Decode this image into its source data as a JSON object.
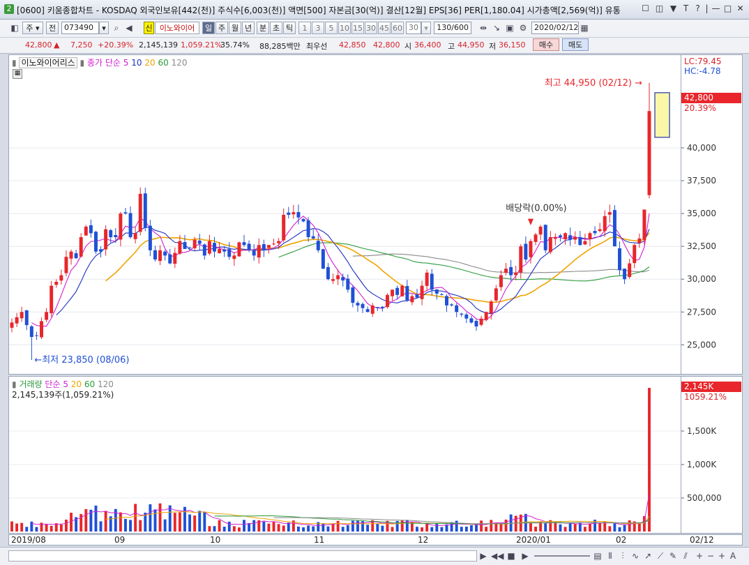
{
  "window": {
    "badge": "2",
    "title": "[0600] 키움종합차트 - KOSDAQ 외국인보유[442(천)] 주식수[6,003(천)] 액면[500] 자본금[30(억)] 결산[12월] EPS[36] PER[1,180.04] 시가총액[2,569(억)] 유통",
    "controls": [
      "☐",
      "◫",
      "▼",
      "T",
      "?",
      "|",
      "—",
      "□",
      "✕"
    ]
  },
  "toolbar": {
    "market_sel": "주",
    "prev_label": "전",
    "code": "073490",
    "badge_sin": "신",
    "stock_name": "이노와이어",
    "periods": [
      "일",
      "주",
      "월",
      "년",
      "분",
      "초",
      "틱"
    ],
    "active_period": "일",
    "minutes": [
      "1",
      "3",
      "5",
      "10",
      "15",
      "30",
      "45",
      "60",
      "30"
    ],
    "count": "130/600",
    "date": "2020/02/12"
  },
  "quote": {
    "price": "42,800",
    "arrow": "▲",
    "change": "7,250",
    "change_pct": "+20.39%",
    "volume": "2,145,139",
    "vol_ratio": "1,059.21%",
    "turnover": "35.74%",
    "amount": "88,285백만",
    "best_label": "최우선",
    "best_ask": "42,850",
    "best_bid": "42,800",
    "open_label": "시",
    "open": "36,400",
    "high_label": "고",
    "high": "44,950",
    "low_label": "저",
    "low": "36,150",
    "buy_label": "매수",
    "sell_label": "매도"
  },
  "price_panel": {
    "name": "이노와이어리스",
    "ma_label": "종가 단순",
    "ma_periods": [
      "5",
      "10",
      "20",
      "60",
      "120"
    ],
    "lc": "LC:79.45",
    "hc": "HC:-4.78",
    "high_note": "최고 44,950 (02/12)",
    "low_note": "최저 23,850 (08/06)",
    "dividend_note": "배당락(0.00%)",
    "last_price_label": "42,800",
    "last_pct_label": "20.39%",
    "y_ticks": [
      "40,000",
      "37,500",
      "35,000",
      "32,500",
      "30,000",
      "27,500",
      "25,000"
    ]
  },
  "volume_panel": {
    "name": "거래량",
    "ma_label": "단순",
    "ma_periods": [
      "5",
      "20",
      "60",
      "120"
    ],
    "current": "2,145,139주(1,059.21%)",
    "last_label": "2,145K",
    "last_pct": "1059.21%",
    "y_ticks": [
      "1,500K",
      "1,000K",
      "500,000"
    ]
  },
  "date_axis": {
    "labels": [
      "2019/08",
      "09",
      "10",
      "11",
      "12",
      "2020/01",
      "02"
    ],
    "last_date": "02/12"
  },
  "colors": {
    "up": "#e8262b",
    "down": "#1f50d6",
    "ma5": "#d21fd2",
    "ma10": "#1d2fbf",
    "ma20": "#f0a400",
    "ma60": "#2a9a3a",
    "ma120": "#8a8a8a"
  },
  "chart_data": {
    "type": "candlestick",
    "ylim": [
      23000,
      46000
    ],
    "y_ticks": [
      25000,
      27500,
      30000,
      32500,
      35000,
      37500,
      40000
    ],
    "volume_ylim": [
      0,
      2250000
    ],
    "volume_ticks": [
      500000,
      1000000,
      1500000
    ],
    "closes": [
      26700,
      27100,
      27500,
      26500,
      25600,
      25700,
      26800,
      27500,
      29500,
      29800,
      30300,
      31700,
      32100,
      31600,
      33200,
      34000,
      33500,
      32100,
      32100,
      33800,
      33200,
      33200,
      35000,
      35000,
      33200,
      33500,
      36500,
      33900,
      32200,
      31500,
      32200,
      31800,
      31200,
      32000,
      32900,
      32300,
      32400,
      33000,
      32700,
      31800,
      32900,
      32100,
      32300,
      32100,
      31700,
      31800,
      32800,
      32600,
      32200,
      31800,
      32600,
      32200,
      32600,
      32700,
      32900,
      34900,
      34900,
      35100,
      34700,
      34400,
      33200,
      33100,
      32200,
      30800,
      30000,
      30000,
      30300,
      29900,
      29200,
      28200,
      28000,
      27800,
      27500,
      28000,
      27800,
      27800,
      28800,
      29200,
      28800,
      29500,
      28400,
      28700,
      28600,
      29500,
      30500,
      29200,
      28900,
      28800,
      28000,
      28000,
      27500,
      27300,
      27000,
      26700,
      26400,
      27000,
      27500,
      28300,
      29300,
      30300,
      30800,
      30300,
      30500,
      32500,
      31500,
      32900,
      33400,
      34000,
      32200,
      33200,
      33200,
      33200,
      33500,
      33000,
      33200,
      32600,
      32900,
      33500,
      33500,
      33800,
      34800,
      35100,
      32500,
      30700,
      30000,
      31200,
      32600,
      33100,
      35300,
      42800
    ]
  }
}
